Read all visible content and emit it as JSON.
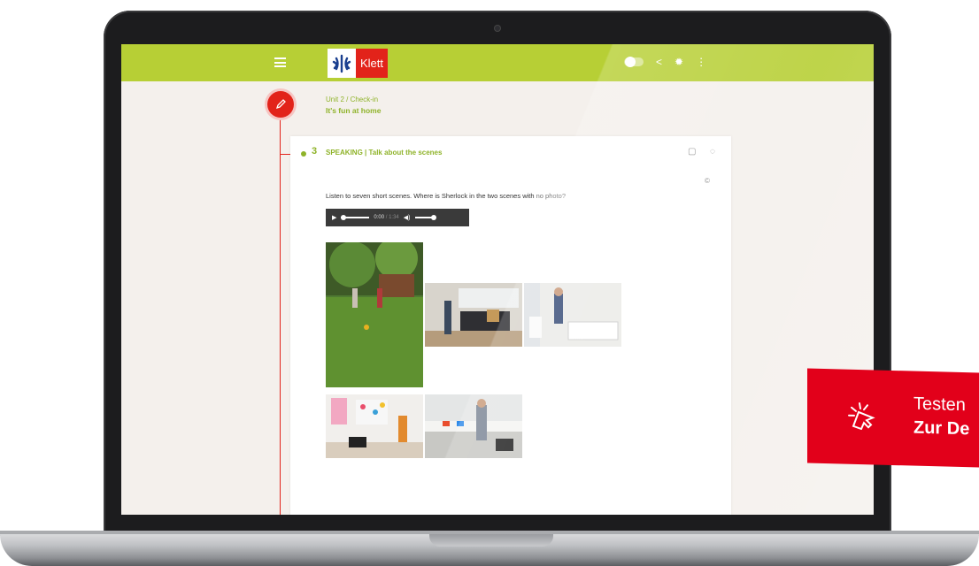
{
  "app": {
    "logo_text": "Klett",
    "brand_colors": {
      "green": "#b7cf35",
      "red": "#e2231a"
    }
  },
  "header": {
    "icons": [
      "menu-icon",
      "toggle",
      "share-icon",
      "gear-icon",
      "more-vertical-icon"
    ]
  },
  "unit": {
    "breadcrumb": "Unit 2 / Check-in",
    "title": "It's fun at home",
    "badge_icon": "pencil-icon"
  },
  "exercise": {
    "number": "3",
    "title": "SPEAKING | Talk about the scenes",
    "icons": [
      "notes-icon",
      "collapse-icon"
    ],
    "copyright": "©",
    "instruction": "Listen to seven short scenes. Where is Sherlock in the two scenes with",
    "instruction_muted": "no photo?",
    "audio": {
      "current_time": "0:00",
      "separator": "/",
      "duration": "1:34",
      "progress": 0
    },
    "photos": [
      {
        "name": "garden-scene"
      },
      {
        "name": "living-room-scene"
      },
      {
        "name": "bathroom-scene"
      },
      {
        "name": "kids-room-scene"
      },
      {
        "name": "kitchen-scene"
      }
    ]
  },
  "promo": {
    "line1": "Testen",
    "line2": "Zur De",
    "icon": "cursor-click-icon"
  }
}
